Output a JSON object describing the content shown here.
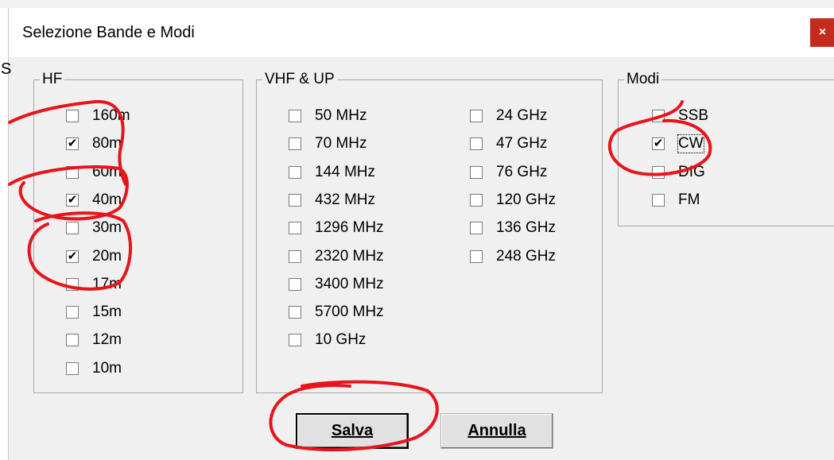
{
  "dialog": {
    "title": "Selezione Bande e Modi",
    "close": "×",
    "edge_char": "S"
  },
  "hf": {
    "legend": "HF",
    "items": [
      {
        "label": "160m",
        "checked": false
      },
      {
        "label": "80m",
        "checked": true
      },
      {
        "label": "60m",
        "checked": false
      },
      {
        "label": "40m",
        "checked": true
      },
      {
        "label": "30m",
        "checked": false
      },
      {
        "label": "20m",
        "checked": true
      },
      {
        "label": "17m",
        "checked": false
      },
      {
        "label": "15m",
        "checked": false
      },
      {
        "label": "12m",
        "checked": false
      },
      {
        "label": "10m",
        "checked": false
      }
    ]
  },
  "vhf": {
    "legend": "VHF & UP",
    "col1": [
      {
        "label": "50 MHz",
        "checked": false
      },
      {
        "label": "70 MHz",
        "checked": false
      },
      {
        "label": "144 MHz",
        "checked": false
      },
      {
        "label": "432 MHz",
        "checked": false
      },
      {
        "label": "1296 MHz",
        "checked": false
      },
      {
        "label": "2320 MHz",
        "checked": false
      },
      {
        "label": "3400 MHz",
        "checked": false
      },
      {
        "label": "5700 MHz",
        "checked": false
      },
      {
        "label": "10 GHz",
        "checked": false
      }
    ],
    "col2": [
      {
        "label": "24 GHz",
        "checked": false
      },
      {
        "label": "47 GHz",
        "checked": false
      },
      {
        "label": "76 GHz",
        "checked": false
      },
      {
        "label": "120 GHz",
        "checked": false
      },
      {
        "label": "136 GHz",
        "checked": false
      },
      {
        "label": "248 GHz",
        "checked": false
      }
    ]
  },
  "modi": {
    "legend": "Modi",
    "items": [
      {
        "label": "SSB",
        "checked": false
      },
      {
        "label": "CW",
        "checked": true
      },
      {
        "label": "DIG",
        "checked": false
      },
      {
        "label": "FM",
        "checked": false
      }
    ]
  },
  "buttons": {
    "save": "Salva",
    "cancel": "Annulla"
  },
  "colors": {
    "annotation": "#e8141b",
    "close_bg": "#c42b1c"
  }
}
